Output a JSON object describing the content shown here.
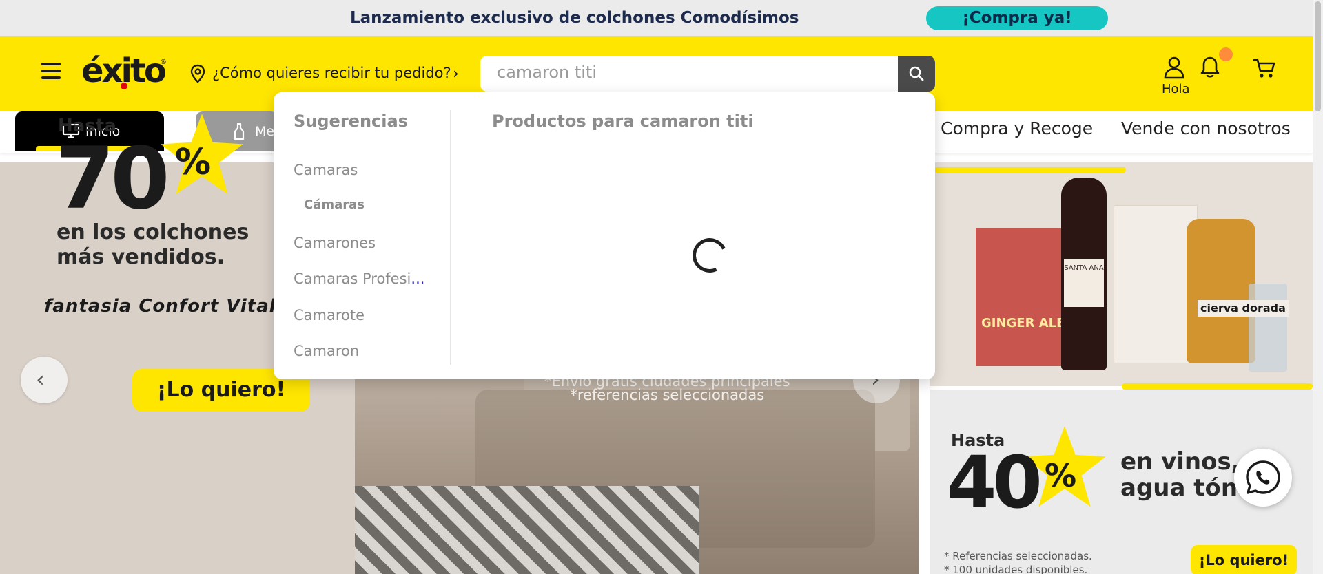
{
  "promo": {
    "text": "Lanzamiento exclusivo de colchones Comodísimos",
    "cta": "¡Compra ya!"
  },
  "header": {
    "logo": "éxito",
    "logo_reg": "®",
    "delivery_prompt": "¿Cómo quieres recibir tu pedido?",
    "search": {
      "value": "camaron titi",
      "placeholder": ""
    },
    "account_label": "Hola",
    "notification_badge": true
  },
  "nav": {
    "inicio": "Inicio",
    "mercado": "Me",
    "links": [
      "Compra y Recoge",
      "Vende con nosotros"
    ]
  },
  "dropdown": {
    "suggestions_title": "Sugerencias",
    "products_title": "Productos para camaron titi",
    "suggestions": [
      {
        "label": "Camaras",
        "sub": false
      },
      {
        "label": "Cámaras",
        "sub": true
      },
      {
        "label": "Camarones",
        "sub": false
      },
      {
        "label": "Camaras Profesi",
        "sub": false,
        "ellipsis": "..."
      },
      {
        "label": "Camarote",
        "sub": false
      },
      {
        "label": "Camaron",
        "sub": false
      }
    ],
    "loading": true
  },
  "hero_left": {
    "hasta": "Hasta",
    "discount": "70",
    "percent": "%",
    "line1": "en los colchones",
    "line2": "más vendidos.",
    "brands": "fantasia  Confort Vital  Spring  Paraíso",
    "cta": "¡Lo quiero!",
    "envio_line1": "*Envío gratis ciudades principales",
    "envio_line2": "*referencias seleccionadas"
  },
  "hero_right_top": {
    "ginger": "GINGER ALE",
    "wine": "SANTA ANA",
    "cierva": "cierva dorada"
  },
  "hero_right_bottom": {
    "hasta": "Hasta",
    "discount": "40",
    "percent": "%",
    "line1": "en vinos, ro",
    "line2": "agua tónic",
    "ref1": "* Referencias seleccionadas.",
    "ref2": "* 100 unidades disponibles.",
    "cta": "¡Lo quiero!"
  },
  "carousel": {
    "prev": "‹",
    "next": "›"
  },
  "colors": {
    "brand_yellow": "#ffe600",
    "promo_cta": "#16c6c2",
    "notification": "#ff8c3a",
    "search_button": "#4a4a4a"
  }
}
